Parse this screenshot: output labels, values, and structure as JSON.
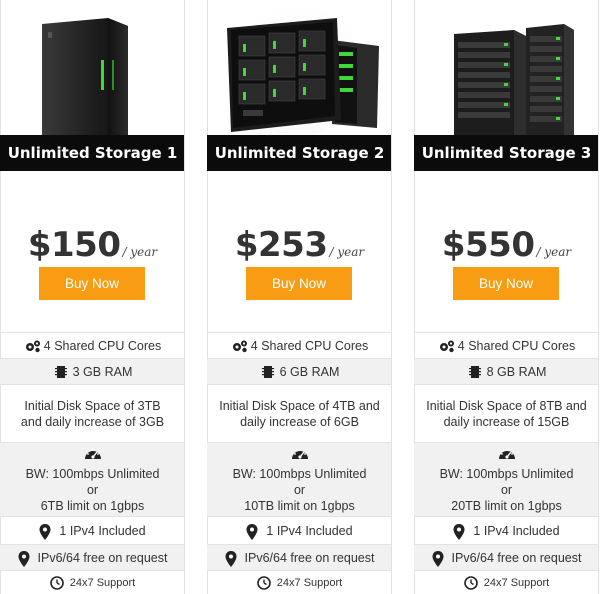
{
  "plans": [
    {
      "title": "Unlimited Storage 1",
      "price": "$150",
      "period": "/ year",
      "buy_label": "Buy Now",
      "cpu": "4 Shared CPU Cores",
      "ram": "3 GB RAM",
      "disk_line1": "Initial Disk Space of 3TB",
      "disk_line2": "and daily increase of 3GB",
      "bw_line1": "BW: 100mbps Unlimited",
      "bw_or": "or",
      "bw_line2": "6TB limit on 1gbps",
      "ipv4": "1 IPv4 Included",
      "ipv6": "IPv6/64 free on request",
      "support": "24x7 Support"
    },
    {
      "title": "Unlimited Storage 2",
      "price": "$253",
      "period": "/ year",
      "buy_label": "Buy Now",
      "cpu": "4 Shared CPU Cores",
      "ram": "6 GB RAM",
      "disk_line1": "Initial Disk Space of 4TB and",
      "disk_line2": "daily increase of 6GB",
      "bw_line1": "BW: 100mbps Unlimited",
      "bw_or": "or",
      "bw_line2": "10TB limit on 1gbps",
      "ipv4": "1 IPv4 Included",
      "ipv6": "IPv6/64 free on request",
      "support": "24x7 Support"
    },
    {
      "title": "Unlimited Storage 3",
      "price": "$550",
      "period": "/ year",
      "buy_label": "Buy Now",
      "cpu": "4 Shared CPU Cores",
      "ram": "8 GB RAM",
      "disk_line1": "Initial Disk Space of 8TB and",
      "disk_line2": "daily increase of 15GB",
      "bw_line1": "BW: 100mbps Unlimited",
      "bw_or": "or",
      "bw_line2": "20TB limit on 1gbps",
      "ipv4": "1 IPv4 Included",
      "ipv6": "IPv6/64 free on request",
      "support": "24x7 Support"
    }
  ],
  "colors": {
    "accent": "#f89d13",
    "title_bar": "#0b0b0b",
    "row_alt": "#f1f1f1",
    "server_led": "#3fd83a"
  },
  "icons": [
    "server-tower-image",
    "server-cluster-image",
    "server-rack-image",
    "gears-icon",
    "memory-chip-icon",
    "speedometer-icon",
    "map-pin-icon",
    "clock-icon"
  ]
}
